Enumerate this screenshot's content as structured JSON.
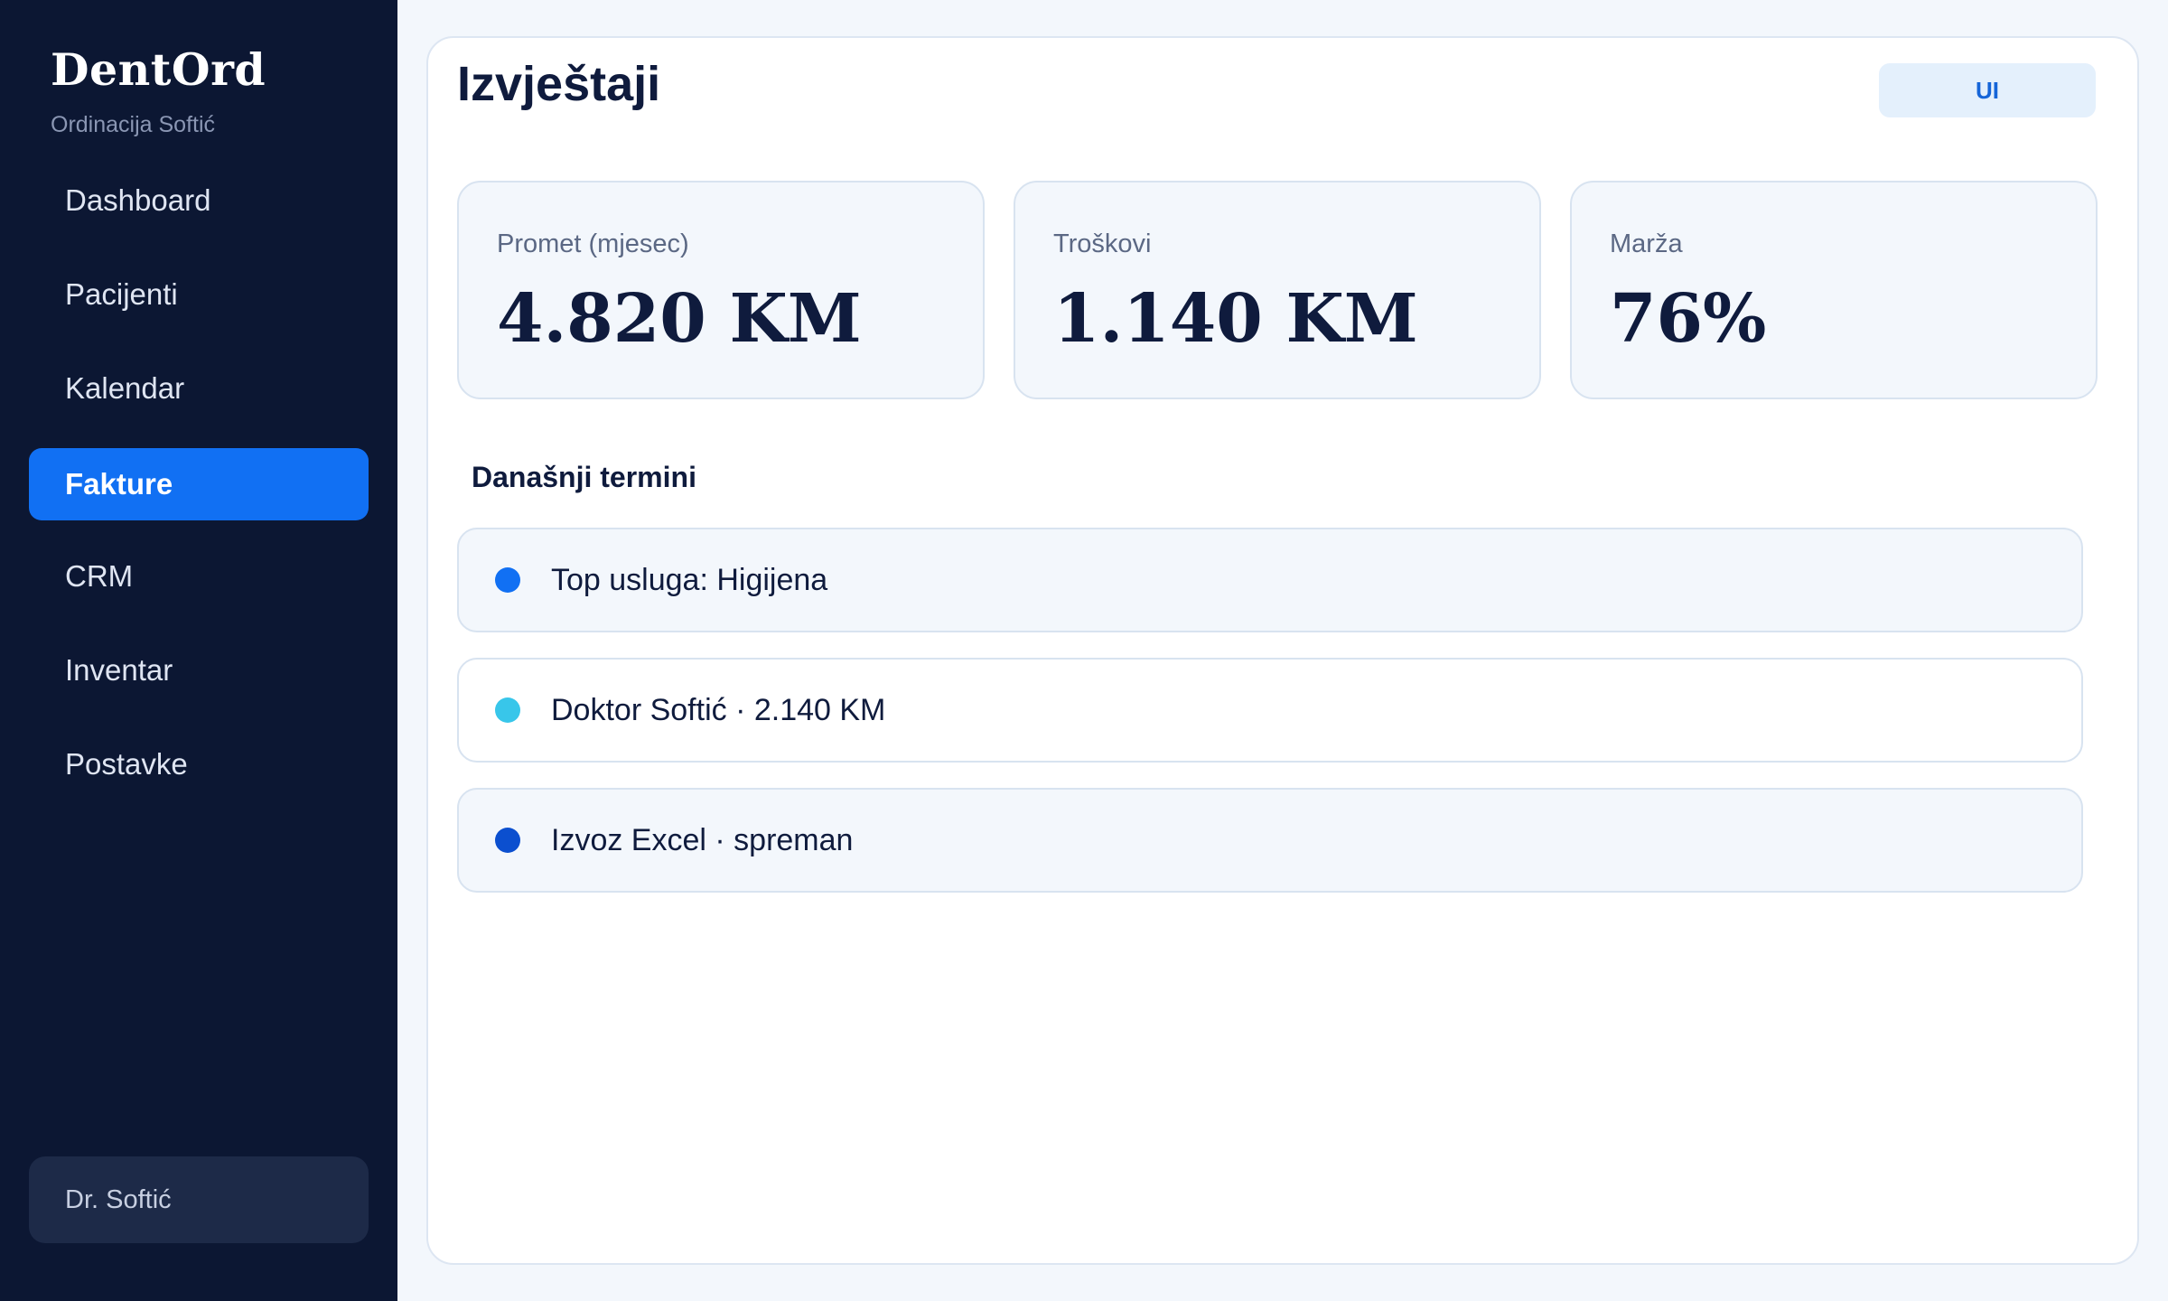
{
  "sidebar": {
    "brand": "DentOrd",
    "clinic": "Ordinacija Softić",
    "items": [
      {
        "label": "Dashboard"
      },
      {
        "label": "Pacijenti"
      },
      {
        "label": "Kalendar"
      },
      {
        "label": "Fakture",
        "active": true
      },
      {
        "label": "CRM"
      },
      {
        "label": "Inventar"
      },
      {
        "label": "Postavke"
      }
    ],
    "user": "Dr. Softić"
  },
  "header": {
    "title": "Izvještaji",
    "badge": "UI"
  },
  "stats": [
    {
      "label": "Promet (mjesec)",
      "value": "4.820 KM"
    },
    {
      "label": "Troškovi",
      "value": "1.140 KM"
    },
    {
      "label": "Marža",
      "value": "76%"
    }
  ],
  "today": {
    "title": "Današnji termini",
    "items": [
      {
        "text": "Top usluga: Higijena",
        "color": "#1170f3"
      },
      {
        "text": "Doktor Softić · 2.140 KM",
        "color": "#38c6ea"
      },
      {
        "text": "Izvoz Excel · spreman",
        "color": "#0b4fcf"
      }
    ]
  },
  "colors": {
    "accent": "#1170f3",
    "sidebar_bg": "#0c1733"
  }
}
